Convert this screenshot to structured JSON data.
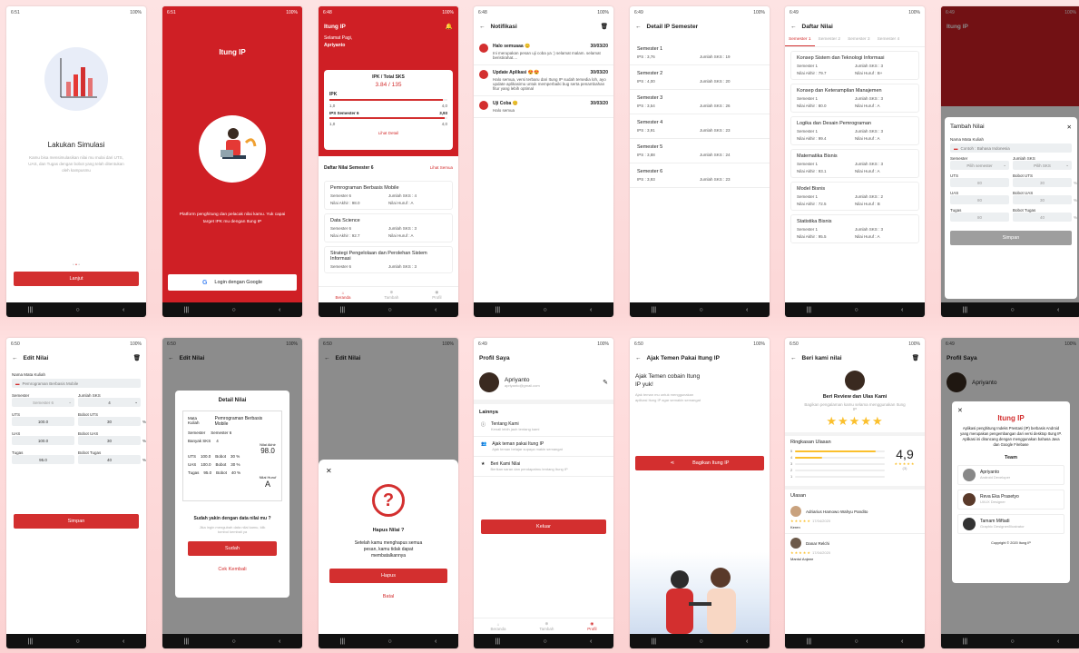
{
  "status": {
    "t1": "6:51",
    "t2": "6:51",
    "t3": "6:48",
    "t4": "6:48",
    "t5": "6:49",
    "t6": "6:49",
    "t7": "6:49",
    "t8": "6:50",
    "t9": "6:50",
    "t10": "6:50",
    "t11": "6:49",
    "t12": "6:50",
    "t13": "6:50",
    "t14": "6:49",
    "right": "100%"
  },
  "s1": {
    "title": "Lakukan Simulasi",
    "desc": "Kamu bisa mensimulasikan nilai mu mulai dari UTS, UAS, dan Tugas dengan bobot yang telah ditentukan oleh kampusmu",
    "btn": "Lanjut"
  },
  "s2": {
    "title": "Itung IP",
    "desc": "Platform penghitung dan pelacak nilai kamu. Yuk capai target IPK mu dengan Itung IP",
    "btn": "Login dengan Google"
  },
  "s3": {
    "app": "Itung IP",
    "greet": "Selamat Pagi,",
    "name": "Apriyanto",
    "card_title": "IPK / Total SKS",
    "ipk_val": "3.84 / 135",
    "ipk": "IPK",
    "min": "1,0",
    "max": "4,0",
    "ips": "IPS Semester 6",
    "ips_val": "3,93",
    "detail": "Lihat Detail",
    "list_title": "Daftar Nilai Semester 6",
    "see_all": "Lihat Semua",
    "items": [
      {
        "name": "Pemrograman Berbasis Mobile",
        "sem": "Semester 6",
        "sks": "Jumlah SKS : 4",
        "akhir": "Nilai Akhir : 98.0",
        "huruf": "Nilai Huruf : A"
      },
      {
        "name": "Data Science",
        "sem": "Semester 6",
        "sks": "Jumlah SKS : 3",
        "akhir": "Nilai Akhir : 92.7",
        "huruf": "Nilai Huruf : A"
      },
      {
        "name": "Strategi Pengelolaan dan Perolehan Sistem Informasi",
        "sem": "Semester 6",
        "sks": "Jumlah SKS : 3"
      }
    ],
    "nav": [
      "Beranda",
      "Tambah",
      "Profil"
    ]
  },
  "s4": {
    "app": "Notifikasi",
    "items": [
      {
        "title": "Halo semuaaa 😊",
        "date": "30/03/20",
        "body": "Ini merupakan pesan uji coba ya :) selamat malam. selamat beristirahat...."
      },
      {
        "title": "Update Aplikasi 😍😍",
        "date": "30/03/20",
        "body": "Halo semua, versi terbaru dari Itung IP sudah tersedia loh, ayo update aplikasimu untuk memperbaiki bug serta penambahan fitur yang lebih optimal"
      },
      {
        "title": "Uji Coba 😊",
        "date": "30/03/20",
        "body": "Halo semua"
      }
    ]
  },
  "s5": {
    "app": "Detail IP Semester",
    "items": [
      {
        "s": "Semester 1",
        "ips": "IPS : 3,76",
        "sks": "Jumlah SKS : 19"
      },
      {
        "s": "Semester 2",
        "ips": "IPS : 4,00",
        "sks": "Jumlah SKS : 20"
      },
      {
        "s": "Semester 3",
        "ips": "IPS : 3,54",
        "sks": "Jumlah SKS : 26"
      },
      {
        "s": "Semester 4",
        "ips": "IPS : 3,91",
        "sks": "Jumlah SKS : 23"
      },
      {
        "s": "Semester 5",
        "ips": "IPS : 3,88",
        "sks": "Jumlah SKS : 24"
      },
      {
        "s": "Semester 6",
        "ips": "IPS : 3,93",
        "sks": "Jumlah SKS : 23"
      }
    ]
  },
  "s6": {
    "app": "Daftar Nilai",
    "tabs": [
      "Semester 1",
      "Semester 2",
      "Semester 3",
      "Semester 4"
    ],
    "items": [
      {
        "n": "Konsep Sistem dan Teknologi Informasi",
        "s": "Semester 1",
        "k": "Jumlah SKS : 3",
        "a": "Nilai Akhir : 79.7",
        "h": "Nilai Huruf : B+"
      },
      {
        "n": "Konsep dan Keterampilan Manajemen",
        "s": "Semester 1",
        "k": "Jumlah SKS : 3",
        "a": "Nilai Akhir : 80.0",
        "h": "Nilai Huruf : A"
      },
      {
        "n": "Logika dan Desain Pemrograman",
        "s": "Semester 1",
        "k": "Jumlah SKS : 3",
        "a": "Nilai Akhir : 99.4",
        "h": "Nilai Huruf : A"
      },
      {
        "n": "Matematika Bisnis",
        "s": "Semester 1",
        "k": "Jumlah SKS : 3",
        "a": "Nilai Akhir : 93.1",
        "h": "Nilai Huruf : A"
      },
      {
        "n": "Model Bisnis",
        "s": "Semester 1",
        "k": "Jumlah SKS : 2",
        "a": "Nilai Akhir : 72.5",
        "h": "Nilai Huruf : B"
      },
      {
        "n": "Statistika Bisnis",
        "s": "Semester 1",
        "k": "Jumlah SKS : 3",
        "a": "Nilai Akhir : 95.5",
        "h": "Nilai Huruf : A"
      }
    ]
  },
  "s7": {
    "app": "Itung IP",
    "dlg": "Tambah Nilai",
    "mk": "Nama Mata Kuliah",
    "mk_ph": "Contoh : Bahasa Indonesia",
    "sem": "Semester",
    "sem_ph": "Pilih semester",
    "sks": "Jumlah SKS",
    "sks_ph": "Pilih SKS",
    "uts": "UTS",
    "buts": "Bobot UTS",
    "uas": "UAS",
    "buas": "Bobot UAS",
    "tugas": "Tugas",
    "btugas": "Bobot Tugas",
    "v80": "80",
    "v30": "30",
    "v40": "40",
    "pct": "%",
    "btn": "Simpan"
  },
  "s8": {
    "app": "Edit Nilai",
    "mk": "Nama Mata Kuliah",
    "mk_val": "Pemrograman Berbasis Mobile",
    "sem": "Semester",
    "sem_val": "Semester 6",
    "sks": "Jumlah SKS",
    "sks_val": "4",
    "uts": "UTS",
    "uts_val": "100.0",
    "buts": "Bobot UTS",
    "buts_val": "30",
    "uas": "UAS",
    "uas_val": "100.0",
    "buas": "Bobot UAS",
    "buas_val": "30",
    "tugas": "Tugas",
    "tugas_val": "95.0",
    "btugas": "Bobot Tugas",
    "btugas_val": "40",
    "pct": "%",
    "btn": "Simpan"
  },
  "s9": {
    "app": "Edit Nilai",
    "title": "Detail Nilai",
    "mk_l": "Mata Kuliah",
    "mk": "Pemrograman Berbasis Mobile",
    "sem_l": "Semester",
    "sem": "Semester 6",
    "sks_l": "Banyak SKS",
    "sks": "4",
    "na_l": "Nilai Akhir",
    "na": "98.0",
    "uts": "UTS",
    "uts_v": "100.0",
    "uas": "UAS",
    "uas_v": "100.0",
    "tg": "Tugas",
    "tg_v": "95.0",
    "bobot": "Bobot",
    "b30": "30 %",
    "b40": "40 %",
    "nh_l": "Nilai Huruf",
    "nh": "A",
    "q": "Sudah yakin dengan data nilai mu ?",
    "qd": "Jika ingin mengubah data nilai kamu, klik tombol kembali ya",
    "ok": "Sudah",
    "back": "Cek Kembali"
  },
  "s10": {
    "app": "Edit Nilai",
    "title": "Hapus Nilai ?",
    "desc": "Setelah kamu menghapus semua pesan, kamu tidak dapat membatalkannya",
    "ok": "Hapus",
    "cancel": "Batal"
  },
  "s11": {
    "app": "Profil Saya",
    "name": "Apriyanto",
    "email": "apriyanto@gmail.com",
    "section": "Lainnya",
    "items": [
      {
        "t": "Tentang Kami",
        "d": "Kenali lebih jauh tentang kami"
      },
      {
        "t": "Ajak teman pakai Itung IP",
        "d": "Ajak teman belajar supaya makin semangat"
      },
      {
        "t": "Beri Kami Nilai",
        "d": "Berikan saran dan pendapatmu tentang Itung IP"
      }
    ],
    "btn": "Keluar",
    "nav": [
      "Beranda",
      "Tambah",
      "Profil"
    ]
  },
  "s12": {
    "app": "Ajak Temen Pakai Itung IP",
    "h": "Ajak Temen cobain Itung IP yuk!",
    "d": "Ajak teman mu untuk menggunakan aplikasi Itung IP agar semakin semangat",
    "btn": "Bagikan Itung IP"
  },
  "s13": {
    "app": "Beri kami nilai",
    "h": "Beri Review dan Ulas Kami",
    "d": "Bagikan pengalaman kamu selama menggunakan Itung IP",
    "sum": "Ringkasan Ulasan",
    "score": "4,9",
    "count": "(3)",
    "rev": "Ulasan",
    "reviews": [
      {
        "n": "Adriarius Hamowo Wahyu Pandito",
        "d": "17/04/2020",
        "t": "Keren"
      },
      {
        "n": "Danar Relchi",
        "d": "17/04/2020",
        "t": "Mantul Anjeee"
      }
    ],
    "l5": "5",
    "l4": "4",
    "l3": "3",
    "l2": "2",
    "l1": "1",
    "stars": "★★★★★"
  },
  "s14": {
    "app": "Profil Saya",
    "name": "Apriyanto",
    "title": "Itung IP",
    "desc": "Aplikasi penghitung Indeks Prestasi (IP) berbasis Android yang merupakan pengembangan dari versi desktop Itung IP. Aplikasi ini dirancang dengan menggunakan bahasa Java dan Google Firebase",
    "team": "Team",
    "members": [
      {
        "n": "Apriyanto",
        "r": "Android Developer"
      },
      {
        "n": "Reva Eka Prasetyo",
        "r": "UI/UX Designer"
      },
      {
        "n": "Tamam Miftadi",
        "r": "Graphic Designer/Illustrator"
      }
    ],
    "copy": "Copyright © 2020 Itung IP"
  },
  "navsym": {
    "a": "|||",
    "b": "○",
    "c": "‹"
  }
}
